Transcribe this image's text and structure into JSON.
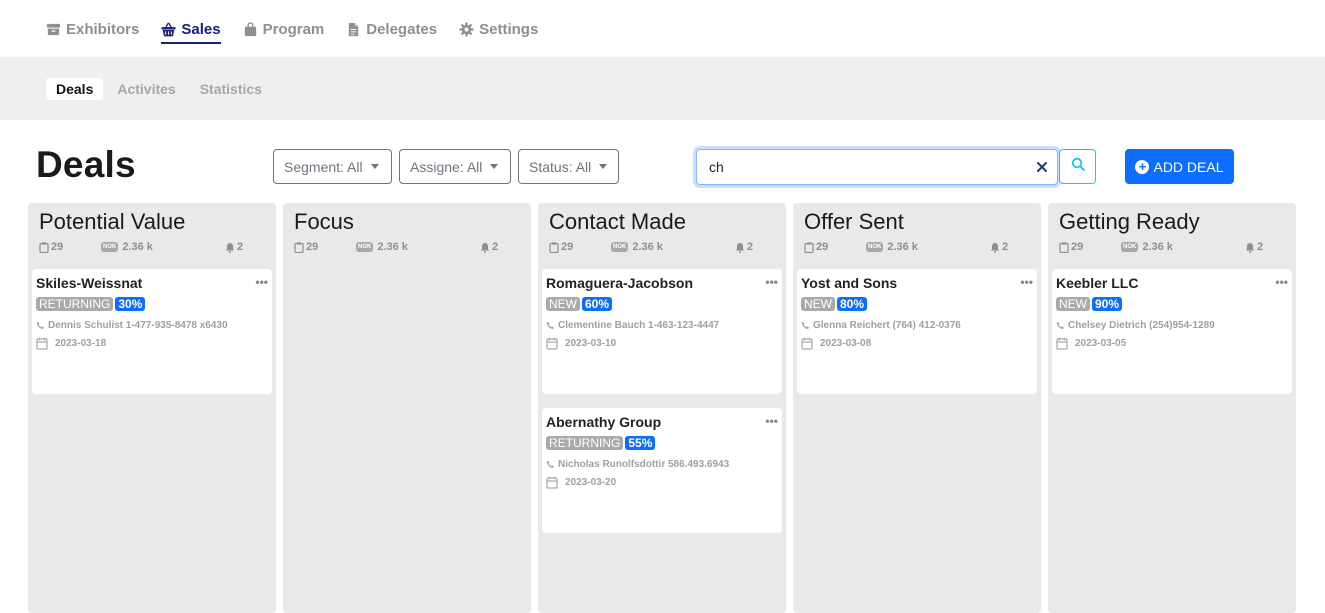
{
  "topnav": {
    "items": [
      {
        "label": "Exhibitors",
        "icon": "archive-icon",
        "active": false
      },
      {
        "label": "Sales",
        "icon": "basket-icon",
        "active": true
      },
      {
        "label": "Program",
        "icon": "bag-icon",
        "active": false
      },
      {
        "label": "Delegates",
        "icon": "file-icon",
        "active": false
      },
      {
        "label": "Settings",
        "icon": "gear-icon",
        "active": false
      }
    ]
  },
  "subnav": {
    "items": [
      {
        "label": "Deals",
        "active": true
      },
      {
        "label": "Activites",
        "active": false
      },
      {
        "label": "Statistics",
        "active": false
      }
    ]
  },
  "page": {
    "title": "Deals",
    "filters": {
      "segment": "Segment: All",
      "assigne": "Assigne: All",
      "status": "Status: All"
    },
    "search": {
      "value": "ch"
    },
    "add_label": "ADD DEAL"
  },
  "colors": {
    "primary": "#0d6efd",
    "nav_active": "#15207a",
    "info": "#0dcaf0"
  },
  "columns": [
    {
      "title": "Potential Value",
      "stats": {
        "count": "29",
        "currency": "NOK",
        "amount": "2.36 k",
        "alerts": "2"
      },
      "cards": [
        {
          "title": "Skiles-Weissnat",
          "type": "RETURNING",
          "probability": "30%",
          "contact": "Dennis Schulist 1-477-935-8478 x6430",
          "date": "2023-03-18"
        }
      ]
    },
    {
      "title": "Focus",
      "stats": {
        "count": "29",
        "currency": "NOK",
        "amount": "2.36 k",
        "alerts": "2"
      },
      "cards": []
    },
    {
      "title": "Contact Made",
      "stats": {
        "count": "29",
        "currency": "NOK",
        "amount": "2.36 k",
        "alerts": "2"
      },
      "cards": [
        {
          "title": "Romaguera-Jacobson",
          "type": "NEW",
          "probability": "60%",
          "contact": "Clementine Bauch 1-463-123-4447",
          "date": "2023-03-10"
        },
        {
          "title": "Abernathy Group",
          "type": "RETURNING",
          "probability": "55%",
          "contact": "Nicholas Runolfsdottir 586.493.6943",
          "date": "2023-03-20"
        }
      ]
    },
    {
      "title": "Offer Sent",
      "stats": {
        "count": "29",
        "currency": "NOK",
        "amount": "2.36 k",
        "alerts": "2"
      },
      "cards": [
        {
          "title": "Yost and Sons",
          "type": "NEW",
          "probability": "80%",
          "contact": "Glenna Reichert (764) 412-0376",
          "date": "2023-03-08"
        }
      ]
    },
    {
      "title": "Getting Ready",
      "stats": {
        "count": "29",
        "currency": "NOK",
        "amount": "2.36 k",
        "alerts": "2"
      },
      "cards": [
        {
          "title": "Keebler LLC",
          "type": "NEW",
          "probability": "90%",
          "contact": "Chelsey Dietrich (254)954-1289",
          "date": "2023-03-05"
        }
      ]
    }
  ]
}
